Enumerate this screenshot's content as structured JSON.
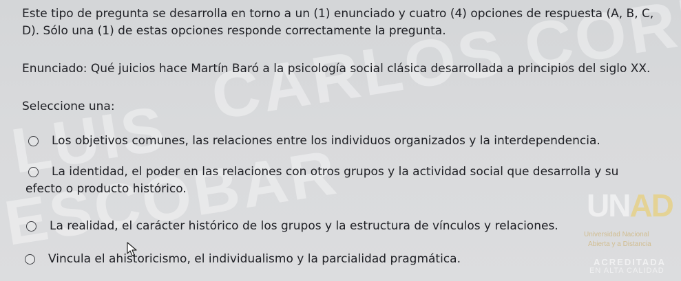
{
  "question": {
    "intro": "Este tipo de pregunta se desarrolla en torno a un (1) enunciado y cuatro (4) opciones de respuesta (A, B, C, D). Sólo una (1) de estas opciones responde correctamente la pregunta.",
    "statement": "Enunciado: Qué juicios hace Martín Baró a la psicología social clásica desarrollada a principios del siglo XX.",
    "select_prompt": "Seleccione una:",
    "options": [
      {
        "label": "Los objetivos comunes, las relaciones entre los individuos organizados y la interdependencia.",
        "selected": false
      },
      {
        "label_line1": "La identidad, el poder en las relaciones con otros grupos y la actividad social que desarrolla y su",
        "label_line2": "efecto o producto histórico.",
        "selected": false
      },
      {
        "label": "La realidad, el carácter histórico de los grupos y la estructura de vínculos y relaciones.",
        "selected": false
      },
      {
        "label": "Vincula el ahistoricismo, el individualismo y la parcialidad pragmática.",
        "selected": false
      }
    ]
  },
  "watermark": {
    "line1": "CARLOS CORDOBA",
    "line2": "LUIS",
    "line3": "ESCOBAR"
  },
  "logo": {
    "mark_main": "UN",
    "mark_accent": "AD",
    "line1": "Universidad Nacional",
    "line2": "Abierta y a Distancia",
    "line3": "ACREDITADA",
    "line4": "EN ALTA CALIDAD"
  }
}
